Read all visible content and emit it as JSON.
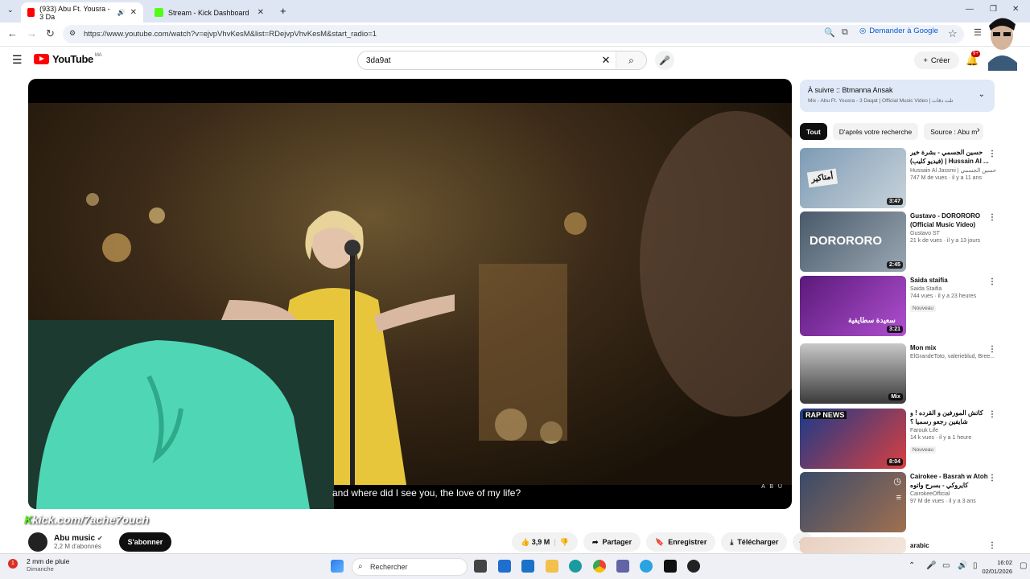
{
  "browser": {
    "tabs": [
      {
        "title": "(933) Abu Ft. Yousra - 3 Da",
        "active": true
      },
      {
        "title": "Stream - Kick Dashboard",
        "active": false
      }
    ],
    "url": "https://www.youtube.com/watch?v=ejvpVhvKesM&list=RDejvpVhvKesM&start_radio=1",
    "google_btn": "Demander à Google"
  },
  "youtube": {
    "logo_text": "YouTube",
    "country": "MA",
    "search_query": "3da9at",
    "create_label": "Créer",
    "notif_count": "9+"
  },
  "player": {
    "subtitle": "and where did I see you, the love of my life?",
    "watermark": "A B U",
    "overlay": "kick.com/7ache7ouch"
  },
  "channel": {
    "name": "Abu music",
    "subs": "2,2 M d'abonnés",
    "subscribe": "S'abonner"
  },
  "actions": {
    "likes": "3,9 M",
    "share": "Partager",
    "save": "Enregistrer",
    "download": "Télécharger"
  },
  "queue": {
    "title": "À suivre :: Btmanna Ansak",
    "subtitle": "Mix - Abu Ft. Yousra - 3 Daqat | Official Music Video | تلت دقات"
  },
  "chips": [
    "Tout",
    "D'après votre recherche",
    "Source : Abu m"
  ],
  "recommendations": [
    {
      "title": "حسين الجسمي - بشرة خير (فيديو كليب) | Hussain Al ...",
      "channel": "Hussain Al Jassmi | حسين الجسمي",
      "meta": "747 M de vues · il y a 11 ans",
      "duration": "3:47",
      "badge": ""
    },
    {
      "title": "Gustavo - DORORORO (Official Music Video)",
      "channel": "Gustavo ST",
      "meta": "21 k de vues · il y a 13 jours",
      "duration": "2:45",
      "badge": ""
    },
    {
      "title": "Saida staifia",
      "channel": "Saida Staifia",
      "meta": "744 vues · il y a 23 heures",
      "duration": "3:21",
      "badge": "Nouveau"
    },
    {
      "title": "Mon mix",
      "channel": "ElGrandeToto, valerieblud, Bree...",
      "meta": "",
      "duration": "Mix",
      "badge": ""
    },
    {
      "title": "كاتش المورفين و القرده ! و شايفين رجعو رسميا ؟",
      "channel": "Farouk Life",
      "meta": "14 k vues · il y a 1 heure",
      "duration": "8:04",
      "badge": "Nouveau"
    },
    {
      "title": "Cairokee - Basrah w Atoh كايروكي - بسرح واتوه",
      "channel": "CairokeeOfficial",
      "meta": "97 M de vues · il y a 3 ans",
      "duration": "",
      "badge": ""
    },
    {
      "title": "arabic",
      "channel": "",
      "meta": "",
      "duration": "",
      "badge": ""
    }
  ],
  "thumb_labels": [
    "أمتاكير",
    "DORORORO",
    "سعيدة سطايفية",
    "",
    "RAP NEWS",
    "",
    ""
  ],
  "taskbar": {
    "weather_title": "2 mm de pluie",
    "weather_sub": "Dimanche",
    "weather_badge": "1",
    "search": "Rechercher",
    "time": "16:02",
    "date": "02/01/2026"
  }
}
